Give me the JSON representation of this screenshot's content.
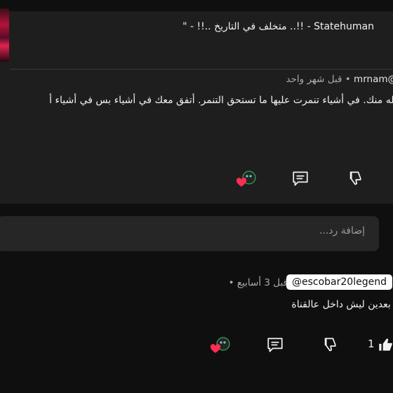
{
  "video": {
    "title": "Statehuman - !!.. متخلف في التاريخ ..!! - \""
  },
  "first_comment": {
    "handle": "@mrnam",
    "time": "قبل شهر واحد",
    "text": "الله منك. في أشياء تنمرت عليها ما تستحق التنمر. أتفق معك في أشياء بس في أشياء أ"
  },
  "reply": {
    "placeholder": "إضافة رد..."
  },
  "second_comment": {
    "handle": "@escobar20legend",
    "time": "قبل 3 أسابيع",
    "text": "و بعدين ليش داخل عالقناة",
    "like_count": "1"
  },
  "icons": {
    "reply": "comment-icon",
    "dislike": "thumbs-down-icon",
    "like": "thumbs-up-icon",
    "creator_heart": "creator-heart-icon"
  },
  "colors": {
    "background": "#0f0f0f",
    "card": "#1e1e1e",
    "heart": "#ff2d55",
    "muted_text": "#aaaaaa"
  }
}
